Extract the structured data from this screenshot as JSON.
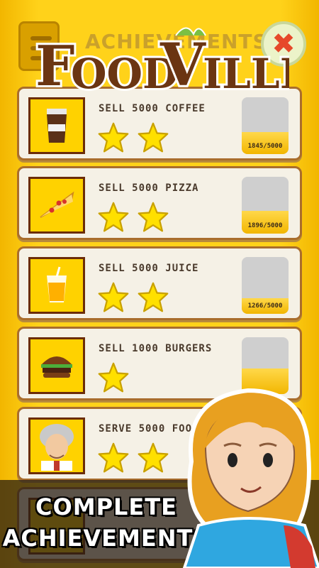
{
  "header": {
    "title": "ACHIEVEMENTS",
    "logo_text": "FOODVILLE",
    "close_glyph": "✖"
  },
  "achievements": [
    {
      "label": "SELL 5000 COFFEE",
      "icon": "coffee-cup-icon",
      "stars": 2,
      "progress": "1845/5000",
      "fraction": 0.369
    },
    {
      "label": "SELL 5000 PIZZA",
      "icon": "pizza-slice-icon",
      "stars": 2,
      "progress": "1896/5000",
      "fraction": 0.379
    },
    {
      "label": "SELL 5000 JUICE",
      "icon": "juice-cup-icon",
      "stars": 2,
      "progress": "1266/5000",
      "fraction": 0.253
    },
    {
      "label": "SELL 1000 BURGERS",
      "icon": "burger-icon",
      "stars": 1,
      "progress": "",
      "fraction": 0.45
    },
    {
      "label": "SERVE 5000 FOOD",
      "icon": "chef-avatar-icon",
      "stars": 2,
      "progress": "",
      "fraction": 0
    }
  ],
  "caption": {
    "line1": "COMPLETE",
    "line2": "ACHIEVEMENTS"
  },
  "colors": {
    "background": "#ffd21a",
    "card": "#f5f1e6",
    "card_border": "#a96d2c",
    "star": "#ffe000",
    "logo_brown": "#6b3512"
  }
}
